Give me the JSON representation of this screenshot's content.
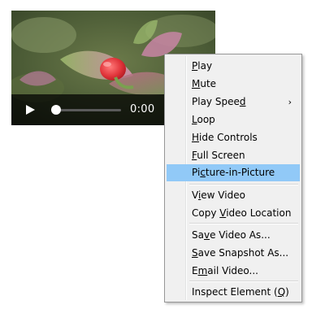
{
  "video": {
    "time_display": "0:00",
    "progress": 0
  },
  "menu": {
    "items": [
      {
        "label": "Play",
        "ul": 0
      },
      {
        "label": "Mute",
        "ul": 0
      },
      {
        "label": "Play Speed",
        "ul": 9,
        "submenu": true
      },
      {
        "label": "Loop",
        "ul": 0
      },
      {
        "label": "Hide Controls",
        "ul": 0
      },
      {
        "label": "Full Screen",
        "ul": 0
      },
      {
        "label": "Picture-in-Picture",
        "ul": 2,
        "highlighted": true
      },
      {
        "label": "View Video",
        "ul": 1
      },
      {
        "label": "Copy Video Location",
        "ul": 5
      },
      {
        "label": "Save Video As...",
        "ul": 2
      },
      {
        "label": "Save Snapshot As...",
        "ul": 0
      },
      {
        "label": "Email Video...",
        "ul": 1
      },
      {
        "label": "Inspect Element (Q)",
        "ul": 17
      }
    ],
    "submenu_arrow": "›"
  },
  "colors": {
    "highlight": "#91c9f7",
    "menu_bg": "#f0f0f0"
  },
  "icons": {
    "play": "play-icon",
    "submenu": "chevron-right-icon"
  }
}
